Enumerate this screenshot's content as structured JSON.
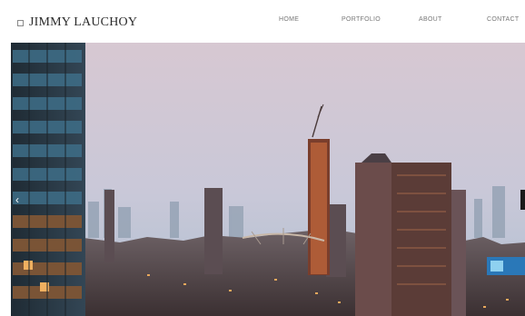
{
  "header": {
    "brand": "JIMMY LAUCHOY",
    "brand_icon": "square-icon"
  },
  "nav": {
    "items": [
      {
        "label": "HOME"
      },
      {
        "label": "PORTFOLIO"
      },
      {
        "label": "ABOUT"
      },
      {
        "label": "CONTACT"
      }
    ]
  },
  "hero": {
    "description": "city-skyline-photo",
    "prev_icon": "‹",
    "sky_top": "#d6c6cf",
    "sky_bottom": "#b7c3d6",
    "city_color": "#5a4a4d",
    "highlight": "#e07838"
  },
  "slider": {
    "prev_icon": "chevron-left-icon",
    "next_icon": "slide-indicator-icon"
  }
}
